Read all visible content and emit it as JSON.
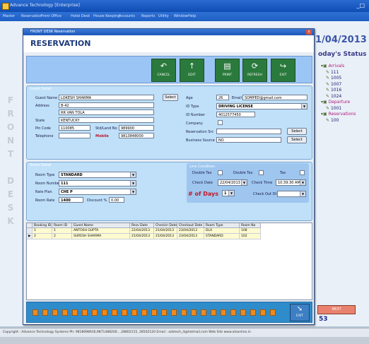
{
  "app": {
    "title": "Advance Technology  [Enterprise]",
    "menu": [
      "Master",
      "Reservation",
      "Front Office",
      "Hotel Desk",
      "House Keeping",
      "Accounts",
      "Reports",
      "Utility",
      "Window",
      "Help"
    ]
  },
  "side": {
    "desk_letters": [
      "F",
      "R",
      "O",
      "N",
      "T",
      "",
      "D",
      "E",
      "S",
      "K"
    ],
    "date": "1/04/2013",
    "status_title": "oday's Status",
    "tree": [
      {
        "label": "Arrivals",
        "type": "head"
      },
      {
        "label": "111",
        "type": "room"
      },
      {
        "label": "1005",
        "type": "room"
      },
      {
        "label": "1007",
        "type": "room"
      },
      {
        "label": "1016",
        "type": "room"
      },
      {
        "label": "1024",
        "type": "room"
      },
      {
        "label": "Departure",
        "type": "head"
      },
      {
        "label": "1001",
        "type": "room"
      },
      {
        "label": "Reservations",
        "type": "head"
      },
      {
        "label": "100",
        "type": "room"
      }
    ],
    "status_button": "NEXT",
    "status_number": "53"
  },
  "window": {
    "title": "FRONT DESK Reservation",
    "close": "x",
    "header": "RESERVATION"
  },
  "toolbar": [
    {
      "label": "CANCEL",
      "icon": "↶"
    },
    {
      "label": "EDIT",
      "icon": "↑"
    },
    {
      "label": "PRINT",
      "icon": "▤"
    },
    {
      "label": "REFRESH",
      "icon": "⟳"
    },
    {
      "label": "EXIT",
      "icon": "↪"
    }
  ],
  "guest": {
    "title": "Guest Detail",
    "guest_name_label": "Guest Name",
    "guest_name": "LOKESH SHARMA",
    "select_label": "Select",
    "address_label": "Address",
    "address1": "B-42",
    "address2": "RR VAN TOLA",
    "state_label": "State",
    "state": "KENTUCKY",
    "pincode_label": "Pin Code",
    "pincode": "110085",
    "std_label": "Std/Land No",
    "std": "989900",
    "telephone_label": "Telephone",
    "mobile_label": "Mobile",
    "mobile": "9813848000",
    "age_label": "Age",
    "age": "26",
    "email_label": "Email",
    "email": "SOMPED@gmail.com",
    "idtype_label": "ID Type",
    "idtype": "DRIVING LICENSE",
    "idnumber_label": "ID Number",
    "idnumber": "4012577450",
    "company_label": "Company",
    "reserv_label": "Reservation Src",
    "business_label": "Business Source",
    "business": "NO",
    "select2_label": "Select",
    "select3_label": "Select"
  },
  "room": {
    "title": "Room Detail",
    "roomtype_label": "Room Type",
    "roomtype": "STANDARD",
    "roomnumber_label": "Room Number",
    "roomnumber": "111",
    "plan_label": "Rate Plan",
    "plan": "CHE P",
    "rate_label": "Room Rate",
    "rate": "1400",
    "discount_label": "Discount %",
    "discount": "0.00",
    "ctype_title": "Line Condition",
    "c1_label": "Double Tax",
    "c2_label": "Double Tax",
    "c3_label": "Tax",
    "checkin_label": "Check Date",
    "checkin_date": "22/04/2013",
    "checkin_time_label": "Check Time",
    "checkin_time": "10:39:30 AM",
    "days_label": "# of Days",
    "days_value": "1",
    "checkout_label": "Check Out Dt",
    "checkout_date": ""
  },
  "grid": {
    "columns": [
      "Booking ID",
      "Room ID",
      "Guest Name",
      "Resv Date",
      "Checkin Date",
      "Checkout Date",
      "Room Type",
      "Room No"
    ],
    "rows": [
      {
        "marker": "",
        "cells": [
          "1",
          "1",
          "ANTOSH GUPTA",
          "22/04/2013",
          "21/04/2013",
          "23/04/2013",
          "DLX",
          "108"
        ]
      },
      {
        "marker": "▶",
        "cells": [
          "2",
          "2",
          "SURESH SHARMA",
          "21/04/2013",
          "21/04/2013",
          "23/04/2013",
          "STANDARD",
          "102"
        ]
      }
    ]
  },
  "bottombar": {
    "count": 25,
    "exit_label": "EXIT"
  },
  "copyright": "Copyright : Advance Technology Systems Ph: 9818098916,9871488200....28802115, 28502120   Email : adstech_it@hotmail.com  Web Site www.atsonline.in"
}
